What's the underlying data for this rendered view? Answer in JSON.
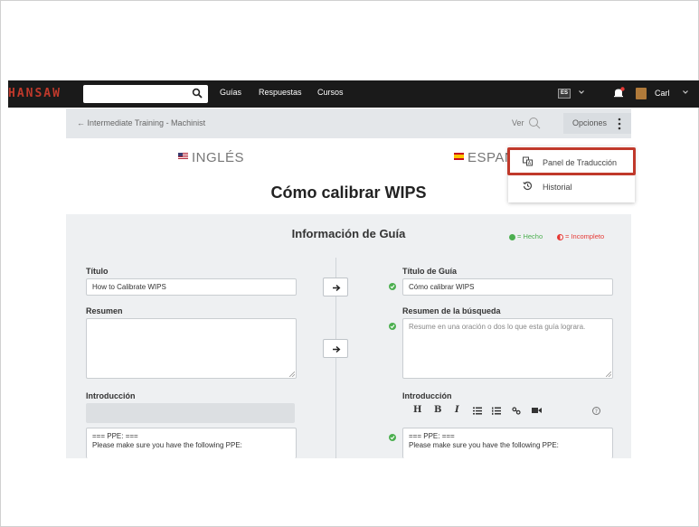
{
  "topnav": {
    "logo": "HANSAW",
    "search_placeholder": "",
    "links": [
      "Guías",
      "Respuestas",
      "Cursos"
    ],
    "lang_code": "ES",
    "user_name": "Carl",
    "accent_color": "#c0392b"
  },
  "breadcrumb": {
    "path": "Intermediate Training - Machinist",
    "ver_label": "Ver",
    "options_label": "Opciones"
  },
  "languages": {
    "source": "INGLÉS",
    "target": "ESPAÑ"
  },
  "dropdown": {
    "items": [
      {
        "label": "Panel de Traducción",
        "icon": "translate-icon"
      },
      {
        "label": "Historial",
        "icon": "history-icon"
      }
    ]
  },
  "guide": {
    "title": "Cómo calibrar WIPS"
  },
  "panel": {
    "title": "Información de Guía",
    "legend_done": "= Hecho",
    "legend_incomplete": "= Incompleto",
    "done_color": "#4caf50",
    "incomplete_color": "#e53935",
    "left": {
      "title_label": "Título",
      "title_value": "How to Calibrate WIPS",
      "summary_label": "Resumen",
      "summary_value": "",
      "intro_label": "Introducción",
      "intro_line1": "=== PPE: ===",
      "intro_line2": "Please make sure you have the following PPE:"
    },
    "right": {
      "title_label": "Título de Guía",
      "title_value": "Cómo calibrar WIPS",
      "summary_label": "Resumen de la búsqueda",
      "summary_placeholder": "Resume en una oración o dos lo que esta guía lograra.",
      "intro_label": "Introducción",
      "intro_line1": "=== PPE: ===",
      "intro_line2": "Please make sure you have the following PPE:",
      "toolbar": [
        "H",
        "B",
        "I"
      ]
    }
  }
}
